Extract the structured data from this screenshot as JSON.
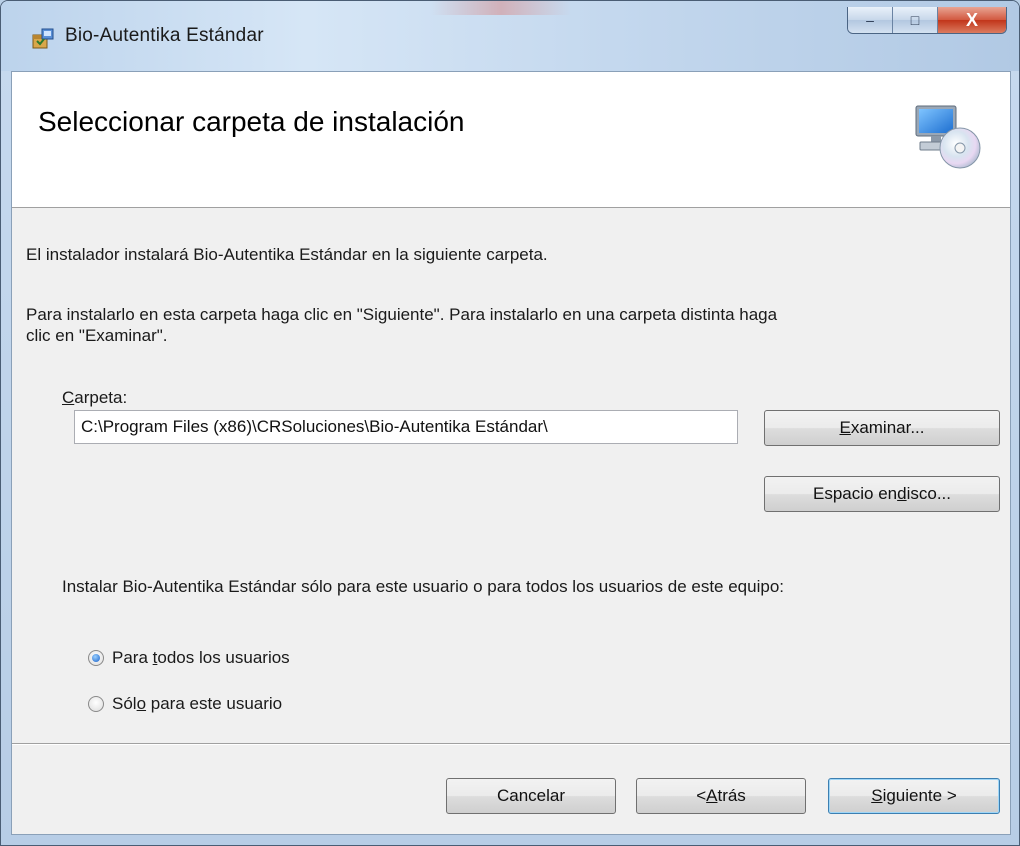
{
  "window": {
    "title": "Bio-Autentika Estándar",
    "controls": {
      "minimize": "–",
      "maximize": "□",
      "close": "X"
    }
  },
  "banner": {
    "title": "Seleccionar carpeta de instalación",
    "icon": "computer-cd-icon"
  },
  "body": {
    "intro": "El instalador instalará Bio-Autentika Estándar en la siguiente carpeta.",
    "instructions_line1": "Para instalarlo en esta carpeta haga clic en \"Siguiente\". Para instalarlo en una carpeta distinta haga",
    "instructions_line2": "clic en \"Examinar\".",
    "folder_label_accel": "C",
    "folder_label_rest": "arpeta:",
    "folder_value": "C:\\Program Files (x86)\\CRSoluciones\\Bio-Autentika Estándar\\",
    "browse_accel": "E",
    "browse_rest": "xaminar...",
    "disk_pre": "Espacio en ",
    "disk_accel": "d",
    "disk_post": "isco...",
    "scope_question": "Instalar Bio-Autentika Estándar sólo para este usuario o para todos los usuarios de este equipo:",
    "radio_all_pre": "Para ",
    "radio_all_accel": "t",
    "radio_all_post": "odos los usuarios",
    "radio_all_checked": true,
    "radio_me_pre": "Sól",
    "radio_me_accel": "o",
    "radio_me_post": " para este usuario",
    "radio_me_checked": false
  },
  "footer": {
    "cancel": "Cancelar",
    "back_pre": "< ",
    "back_accel": "A",
    "back_post": "trás",
    "next_accel": "S",
    "next_post": "iguiente >"
  },
  "colors": {
    "frame": "#b9cfe6",
    "close_button": "#c7432a",
    "dialog_bg": "#f0f0f0",
    "default_button_border": "#3c7fb1"
  }
}
